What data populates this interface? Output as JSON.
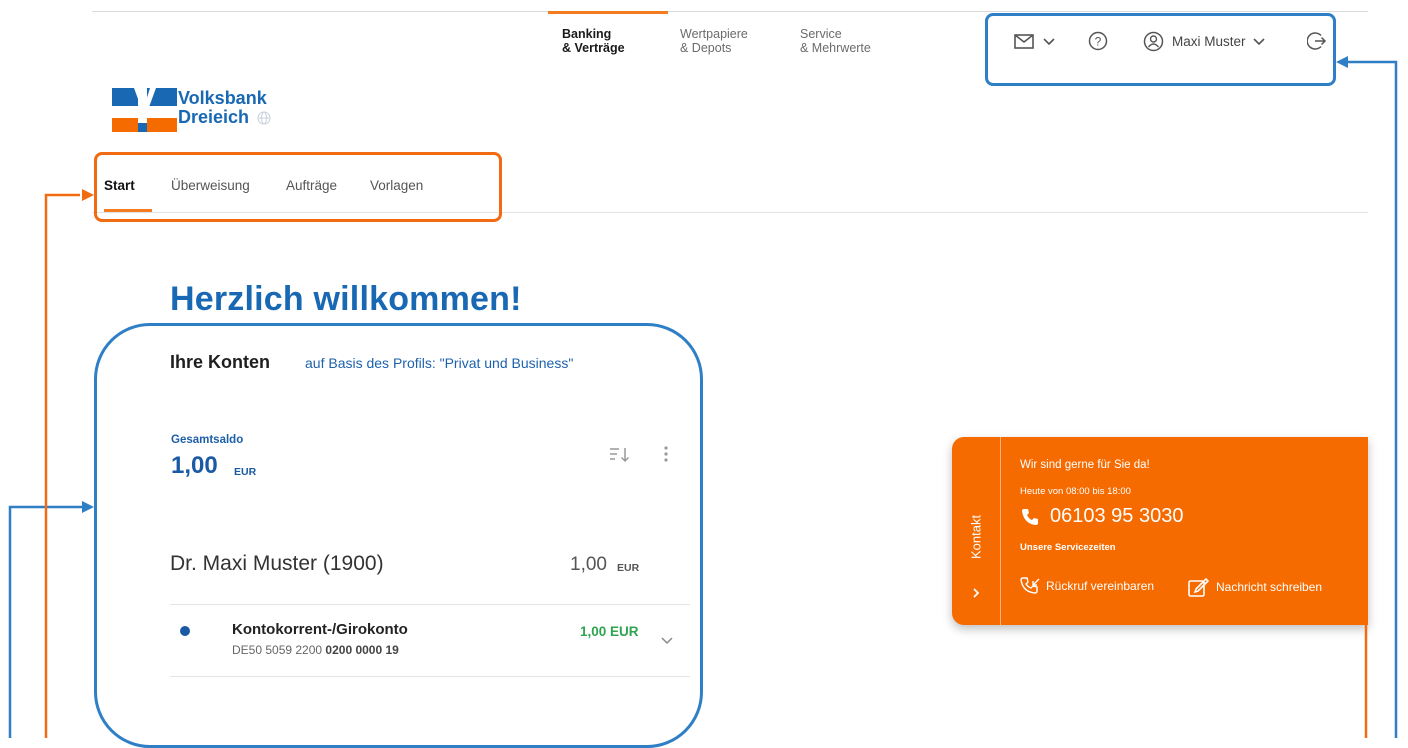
{
  "header": {
    "nav": [
      {
        "line1": "Banking",
        "line2": "& Verträge",
        "active": true
      },
      {
        "line1": "Wertpapiere",
        "line2": "& Depots",
        "active": false
      },
      {
        "line1": "Service",
        "line2": "& Mehrwerte",
        "active": false
      }
    ],
    "user_name": "Maxi Muster",
    "icons": [
      "mail-icon",
      "help-icon",
      "user-icon",
      "logout-icon"
    ]
  },
  "logo": {
    "line1": "Volksbank",
    "line2": "Dreieich"
  },
  "subnav": [
    "Start",
    "Überweisung",
    "Aufträge",
    "Vorlagen"
  ],
  "main": {
    "welcome": "Herzlich willkommen!",
    "konten_title": "Ihre Konten",
    "konten_profile": "auf Basis des Profils: \"Privat und Business\"",
    "gesamtsaldo_label": "Gesamtsaldo",
    "gesamtsaldo_amount": "1,00",
    "currency": "EUR",
    "owner": {
      "name": "Dr. Maxi Muster (1900)",
      "amount": "1,00",
      "currency": "EUR"
    },
    "account": {
      "name": "Kontokorrent-/Girokonto",
      "iban_prefix": "DE50 5059 2200",
      "iban_bold": "0200 0000 19",
      "amount": "1,00 EUR"
    }
  },
  "kontakt": {
    "tab_label": "Kontakt",
    "line1": "Wir sind gerne für Sie da!",
    "line2": "Heute von 08:00 bis 18:00",
    "phone": "06103 95 3030",
    "line3": "Unsere Servicezeiten",
    "action1": "Rückruf vereinbaren",
    "action2": "Nachricht schreiben"
  },
  "colors": {
    "brand_blue": "#1868b4",
    "brand_orange": "#f56b00",
    "annotation_blue": "#2f7fc6",
    "annotation_orange": "#f26b12",
    "positive": "#2ea44f"
  }
}
